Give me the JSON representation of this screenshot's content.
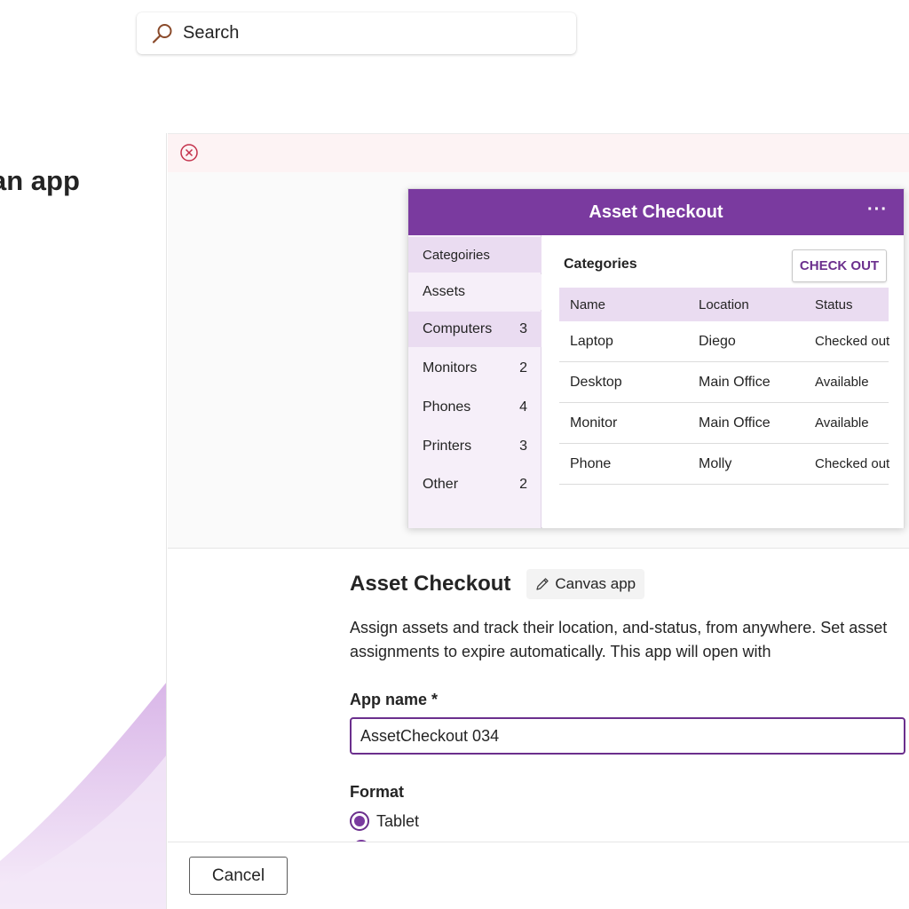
{
  "search": {
    "label": "Search"
  },
  "left_panel": {
    "title": "an app"
  },
  "preview": {
    "header_title": "Asset Checkout",
    "more_label": "···",
    "sidebar": [
      {
        "label": "Categoiries",
        "count": ""
      },
      {
        "label": "Assets",
        "count": ""
      },
      {
        "label": "Computers",
        "count": "3"
      },
      {
        "label": "Monitors",
        "count": "2"
      },
      {
        "label": "Phones",
        "count": "4"
      },
      {
        "label": "Printers",
        "count": "3"
      },
      {
        "label": "Other",
        "count": "2"
      }
    ],
    "main_title": "Categories",
    "checkout_label": "CHECK OUT",
    "table": {
      "headers": [
        "Name",
        "Location",
        "Status"
      ],
      "rows": [
        [
          "Laptop",
          "Diego",
          "Checked out"
        ],
        [
          "Desktop",
          "Main Office",
          "Available"
        ],
        [
          "Monitor",
          "Main Office",
          "Available"
        ],
        [
          "Phone",
          "Molly",
          "Checked out"
        ]
      ]
    }
  },
  "form": {
    "app_title": "Asset Checkout",
    "badge_label": "Canvas app",
    "description": "Assign assets and track their location, and-status, from anywhere. Set asset assignments to expire automatically. This app will open with",
    "app_name_label": "App name *",
    "app_name_value": "AssetCheckout 034",
    "format_label": "Format",
    "format_option": "Tablet"
  },
  "footer": {
    "cancel_label": "Cancel"
  },
  "colors": {
    "accent": "#7a3a9f",
    "accent_dark": "#6b2f8d",
    "accent_light": "#eadcf1",
    "error_bg": "#fdf3f4",
    "error_icon": "#c4314b"
  },
  "icons": {
    "search": "search-icon",
    "error": "error-circle-icon",
    "edit": "pencil-icon",
    "more": "more-icon"
  }
}
